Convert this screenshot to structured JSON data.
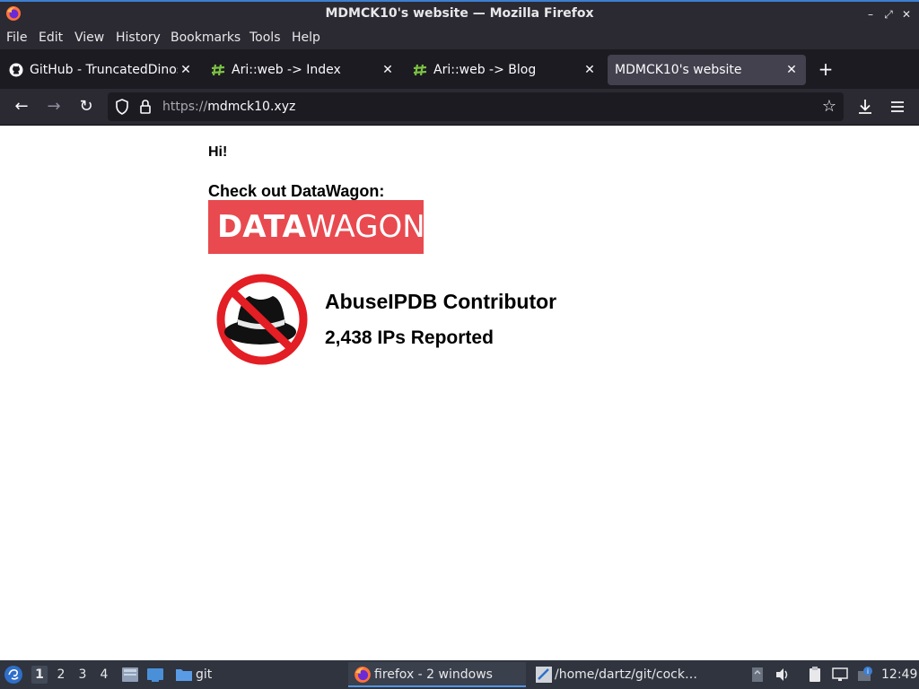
{
  "window": {
    "title": "MDMCK10's website — Mozilla Firefox"
  },
  "menu": {
    "file": "File",
    "edit": "Edit",
    "view": "View",
    "history": "History",
    "bookmarks": "Bookmarks",
    "tools": "Tools",
    "help": "Help"
  },
  "tabs": [
    {
      "label": "GitHub - TruncatedDinosaur",
      "icon": "github-icon",
      "active": false
    },
    {
      "label": "Ari::web -> Index",
      "icon": "ari-web-icon",
      "active": false
    },
    {
      "label": "Ari::web -> Blog",
      "icon": "ari-web-icon",
      "active": false
    },
    {
      "label": "MDMCK10's website",
      "icon": "",
      "active": true
    }
  ],
  "navbar": {
    "url_scheme": "https://",
    "url_host": "mdmck10.xyz"
  },
  "page": {
    "greeting": "Hi!",
    "datawagon_heading": "Check out DataWagon:",
    "datawagon_logo_bold": "DATA",
    "datawagon_logo_light": "WAGON",
    "abuse_title": "AbuseIPDB Contributor",
    "abuse_count": "2,438 IPs Reported"
  },
  "taskbar": {
    "workspaces": [
      "1",
      "2",
      "3",
      "4"
    ],
    "active_workspace": "1",
    "folder_label": "git",
    "tasks": [
      {
        "label": "firefox - 2 windows",
        "active": true
      },
      {
        "label": "/home/dartz/git/cock…",
        "active": false
      }
    ],
    "clock": "12:49"
  },
  "colors": {
    "accent": "#3d7fd1",
    "datawagon_red": "#e84a4f",
    "badge_red": "#e31e24"
  }
}
